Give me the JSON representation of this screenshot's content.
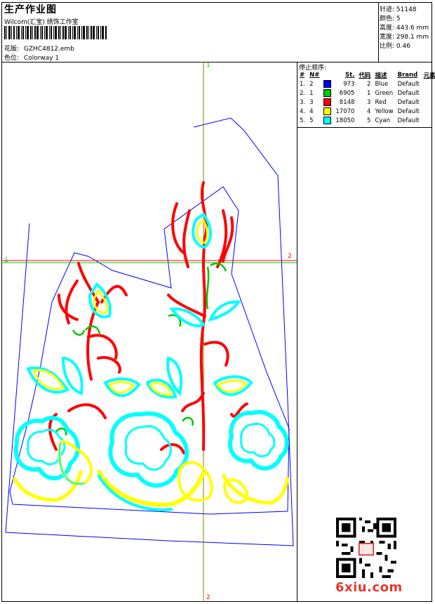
{
  "header": {
    "title": "生产作业图",
    "company": "Wilcom(汇宝) 绣饰工作室",
    "design_name_label": "花版:",
    "design_name": "GZHC4812.emb",
    "colorway_label": "色位:",
    "colorway": "Colorway 1"
  },
  "stats": [
    {
      "label": "针迹:",
      "value": "51148"
    },
    {
      "label": "颜色:",
      "value": "5"
    },
    {
      "label": "高度:",
      "value": "443.6 mm"
    },
    {
      "label": "宽度:",
      "value": "298.1 mm"
    },
    {
      "label": "比例:",
      "value": "0.46"
    }
  ],
  "stop_sequence": {
    "title": "停止顺序:",
    "columns": [
      "#",
      "N#",
      "St.",
      "代码",
      "描述",
      "Brand",
      "元素"
    ],
    "rows": [
      {
        "idx": "1.",
        "n": "2",
        "st": "973",
        "code": "2",
        "desc": "Blue",
        "brand": "Default",
        "color": "#0000ff"
      },
      {
        "idx": "2.",
        "n": "1",
        "st": "6905",
        "code": "1",
        "desc": "Green",
        "brand": "Default",
        "color": "#00c800"
      },
      {
        "idx": "3.",
        "n": "3",
        "st": "8148",
        "code": "3",
        "desc": "Red",
        "brand": "Default",
        "color": "#ff0000"
      },
      {
        "idx": "4.",
        "n": "4",
        "st": "17070",
        "code": "4",
        "desc": "Yellow",
        "brand": "Default",
        "color": "#ffff00"
      },
      {
        "idx": "5.",
        "n": "5",
        "st": "18050",
        "code": "5",
        "desc": "Cyan",
        "brand": "Default",
        "color": "#00ffff"
      }
    ]
  },
  "axes": {
    "top": "1",
    "bottom": "2",
    "left": "1",
    "right": "2"
  },
  "watermark": "6xiu.com",
  "colors": {
    "outline": "#0000ff",
    "green": "#00c800",
    "red": "#ff0000",
    "yellow": "#ffff00",
    "cyan": "#00ffff",
    "vertical_axis": "#808000",
    "horizontal_axis_red": "#ff0000",
    "horizontal_axis_green": "#00c800"
  },
  "icons": [
    "barcode-icon",
    "qr-code-icon"
  ]
}
